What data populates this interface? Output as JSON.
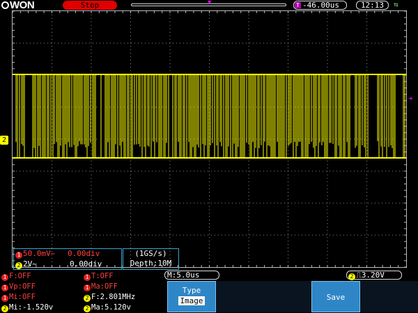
{
  "header": {
    "logo_text": "WON",
    "run_state": "Stop",
    "trigger_position": "-46.00us",
    "trigger_position_icon": "T",
    "clock": "12:13"
  },
  "waveform": {
    "channel_marker": "2",
    "color": "#ffff00",
    "grid_color": "#8a8a8a"
  },
  "vscale": {
    "ch1_num": "1",
    "ch1_scale": "50.0mV~",
    "ch1_offset": "0.00div",
    "ch2_num": "2",
    "ch2_scale": "2V~",
    "ch2_offset": "0.00div"
  },
  "acquisition": {
    "rate": "(1GS/s)",
    "depth": "Depth:10M"
  },
  "timebase": {
    "label": "M:5.0us"
  },
  "trigger": {
    "channel": "2",
    "level": "3.20V"
  },
  "measurements": [
    {
      "ch": "1",
      "text": "F:OFF",
      "color": "red"
    },
    {
      "ch": "1",
      "text": "T:OFF",
      "color": "red"
    },
    {
      "ch": "1",
      "text": "Vp:OFF",
      "color": "red"
    },
    {
      "ch": "1",
      "text": "Ma:OFF",
      "color": "red"
    },
    {
      "ch": "1",
      "text": "Mi:OFF",
      "color": "red"
    },
    {
      "ch": "2",
      "text": "F:2.801MHz",
      "color": "yellow"
    },
    {
      "ch": "2",
      "text": "Mi:-1.520v",
      "color": "yellow"
    },
    {
      "ch": "2",
      "text": "Ma:5.120v",
      "color": "yellow"
    }
  ],
  "menu": {
    "type_label": "Type",
    "type_value": "Image",
    "save_label": "Save"
  }
}
